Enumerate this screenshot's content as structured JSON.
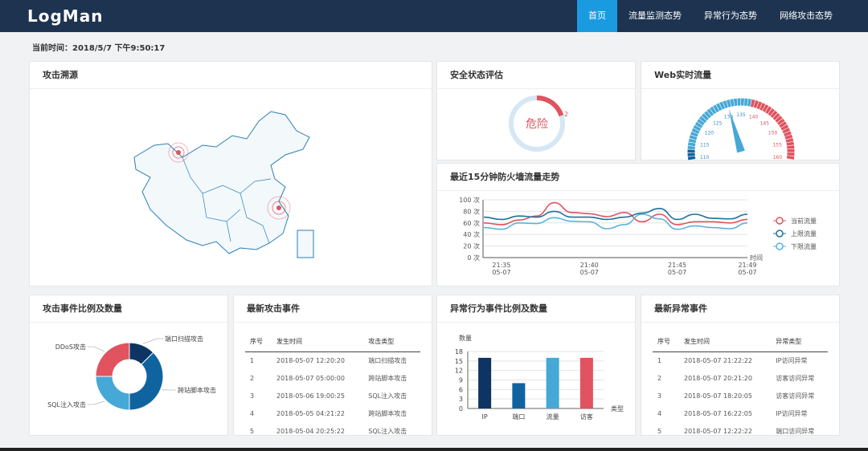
{
  "header": {
    "logo": "LogMan",
    "nav": [
      {
        "label": "首页",
        "active": true
      },
      {
        "label": "流量监测态势"
      },
      {
        "label": "异常行为态势"
      },
      {
        "label": "网络攻击态势"
      }
    ]
  },
  "current_time": "当前时间：2018/5/7 下午9:50:17",
  "panels": {
    "attack_source": {
      "title": "攻击溯源"
    },
    "security": {
      "title": "安全状态评估",
      "status": "危险",
      "value": 2,
      "max": 10,
      "value_label": "2"
    },
    "web_traffic": {
      "title": "Web实时流量",
      "gauge_min": 110,
      "gauge_max": 160,
      "value": 131,
      "ticks": [
        "110",
        "115",
        "120",
        "125",
        "130",
        "135",
        "140",
        "145",
        "150",
        "155",
        "160"
      ]
    },
    "trend": {
      "title": "最近15分钟防火墙流量走势"
    },
    "attack_ratio": {
      "title": "攻击事件比例及数量"
    },
    "latest_attacks": {
      "title": "最新攻击事件",
      "headers": [
        "序号",
        "发生时间",
        "攻击类型"
      ],
      "rows": [
        [
          "1",
          "2018-05-07 12:20:20",
          "端口扫描攻击"
        ],
        [
          "2",
          "2018-05-07 05:00:00",
          "跨站脚本攻击"
        ],
        [
          "3",
          "2018-05-06 19:00:25",
          "SQL注入攻击"
        ],
        [
          "4",
          "2018-05-05 04:21:22",
          "跨站脚本攻击"
        ],
        [
          "5",
          "2018-05-04 20:25:22",
          "SQL注入攻击"
        ]
      ]
    },
    "anomaly_ratio": {
      "title": "异常行为事件比例及数量"
    },
    "latest_anomalies": {
      "title": "最新异常事件",
      "headers": [
        "序号",
        "发生时间",
        "异常类型"
      ],
      "rows": [
        [
          "1",
          "2018-05-07 21:22:22",
          "IP访问异常"
        ],
        [
          "2",
          "2018-05-07 20:21:20",
          "访客访问异常"
        ],
        [
          "3",
          "2018-05-07 18:20:05",
          "访客访问异常"
        ],
        [
          "4",
          "2018-05-07 16:22:05",
          "IP访问异常"
        ],
        [
          "5",
          "2018-05-07 12:22:22",
          "端口访问异常"
        ]
      ]
    }
  },
  "colors": {
    "red": "#e0535f",
    "dark": "#0d3463",
    "mid": "#0f64a0",
    "light": "#46a8d6",
    "ring": "#d5e7f5"
  },
  "chart_data": [
    {
      "type": "line",
      "title": "最近15分钟防火墙流量走势",
      "xlabel": "时间",
      "ylim": [
        0,
        100
      ],
      "yticks": [
        "0 次",
        "20 次",
        "40 次",
        "60 次",
        "80 次",
        "100 次"
      ],
      "ytick_values": [
        0,
        20,
        40,
        60,
        80,
        100
      ],
      "x": [
        "21:34",
        "21:35",
        "21:36",
        "21:37",
        "21:38",
        "21:39",
        "21:40",
        "21:41",
        "21:42",
        "21:43",
        "21:44",
        "21:45",
        "21:46",
        "21:47",
        "21:48",
        "21:49"
      ],
      "xticks": [
        {
          "i": 1,
          "label": "21:35",
          "date": "05-07"
        },
        {
          "i": 6,
          "label": "21:40",
          "date": "05-07"
        },
        {
          "i": 11,
          "label": "21:45",
          "date": "05-07"
        },
        {
          "i": 15,
          "label": "21:49",
          "date": "05-07"
        }
      ],
      "series": [
        {
          "name": "当前流量",
          "color": "#e0535f",
          "values": [
            60,
            57,
            65,
            72,
            95,
            78,
            76,
            71,
            78,
            62,
            75,
            57,
            62,
            62,
            60,
            66
          ]
        },
        {
          "name": "上限流量",
          "color": "#1f6f9c",
          "values": [
            70,
            66,
            72,
            70,
            80,
            70,
            70,
            66,
            70,
            77,
            85,
            66,
            75,
            68,
            67,
            75
          ]
        },
        {
          "name": "下限流量",
          "color": "#5ab4d8",
          "values": [
            52,
            49,
            60,
            59,
            69,
            63,
            62,
            50,
            57,
            75,
            67,
            49,
            55,
            52,
            50,
            60
          ]
        }
      ],
      "legend": "right"
    },
    {
      "type": "pie",
      "title": "攻击事件比例及数量",
      "donut": true,
      "slices": [
        {
          "name": "端口扫描攻击",
          "value": 1,
          "color": "#0d3463"
        },
        {
          "name": "跨站脚本攻击",
          "value": 3,
          "color": "#0f64a0"
        },
        {
          "name": "SQL注入攻击",
          "value": 2,
          "color": "#46a8d6"
        },
        {
          "name": "DDoS攻击",
          "value": 2,
          "color": "#e0535f"
        }
      ]
    },
    {
      "type": "bar",
      "title": "异常行为事件比例及数量",
      "ylabel": "数量",
      "xlabel": "类型",
      "ylim": [
        0,
        18
      ],
      "yticks": [
        "0",
        "3",
        "6",
        "9",
        "12",
        "15",
        "18"
      ],
      "categories": [
        "IP",
        "端口",
        "流量",
        "访客"
      ],
      "values": [
        16,
        8,
        16,
        16
      ],
      "colors": [
        "#0d3463",
        "#0f64a0",
        "#46a8d6",
        "#e0535f"
      ]
    }
  ]
}
